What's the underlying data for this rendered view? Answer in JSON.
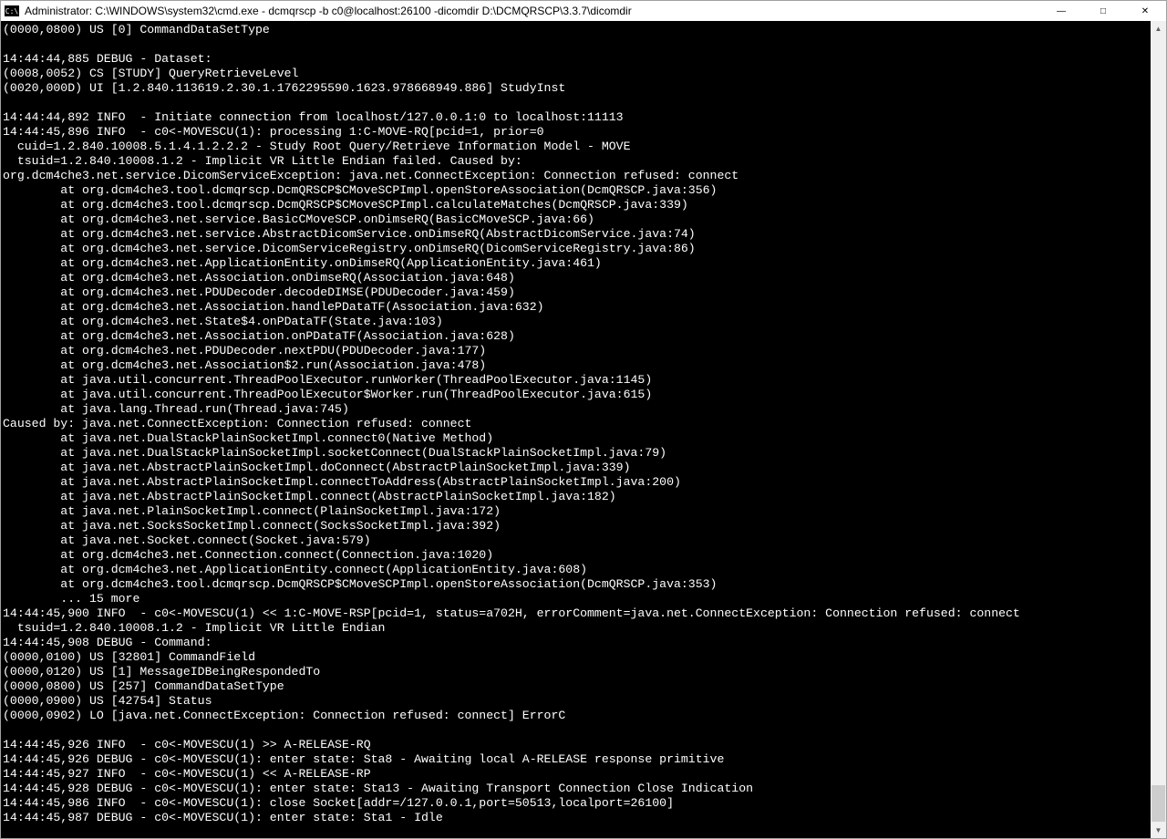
{
  "window": {
    "icon_label": "C:\\",
    "title": "Administrator: C:\\WINDOWS\\system32\\cmd.exe - dcmqrscp  -b c0@localhost:26100 -dicomdir D:\\DCMQRSCP\\3.3.7\\dicomdir"
  },
  "controls": {
    "minimize": "—",
    "maximize": "□",
    "close": "✕"
  },
  "terminal_lines": [
    "(0000,0800) US [0] CommandDataSetType",
    "",
    "14:44:44,885 DEBUG - Dataset:",
    "(0008,0052) CS [STUDY] QueryRetrieveLevel",
    "(0020,000D) UI [1.2.840.113619.2.30.1.1762295590.1623.978668949.886] StudyInst",
    "",
    "14:44:44,892 INFO  - Initiate connection from localhost/127.0.0.1:0 to localhost:11113",
    "14:44:45,896 INFO  - c0<-MOVESCU(1): processing 1:C-MOVE-RQ[pcid=1, prior=0",
    "  cuid=1.2.840.10008.5.1.4.1.2.2.2 - Study Root Query/Retrieve Information Model - MOVE",
    "  tsuid=1.2.840.10008.1.2 - Implicit VR Little Endian failed. Caused by:",
    "org.dcm4che3.net.service.DicomServiceException: java.net.ConnectException: Connection refused: connect",
    "        at org.dcm4che3.tool.dcmqrscp.DcmQRSCP$CMoveSCPImpl.openStoreAssociation(DcmQRSCP.java:356)",
    "        at org.dcm4che3.tool.dcmqrscp.DcmQRSCP$CMoveSCPImpl.calculateMatches(DcmQRSCP.java:339)",
    "        at org.dcm4che3.net.service.BasicCMoveSCP.onDimseRQ(BasicCMoveSCP.java:66)",
    "        at org.dcm4che3.net.service.AbstractDicomService.onDimseRQ(AbstractDicomService.java:74)",
    "        at org.dcm4che3.net.service.DicomServiceRegistry.onDimseRQ(DicomServiceRegistry.java:86)",
    "        at org.dcm4che3.net.ApplicationEntity.onDimseRQ(ApplicationEntity.java:461)",
    "        at org.dcm4che3.net.Association.onDimseRQ(Association.java:648)",
    "        at org.dcm4che3.net.PDUDecoder.decodeDIMSE(PDUDecoder.java:459)",
    "        at org.dcm4che3.net.Association.handlePDataTF(Association.java:632)",
    "        at org.dcm4che3.net.State$4.onPDataTF(State.java:103)",
    "        at org.dcm4che3.net.Association.onPDataTF(Association.java:628)",
    "        at org.dcm4che3.net.PDUDecoder.nextPDU(PDUDecoder.java:177)",
    "        at org.dcm4che3.net.Association$2.run(Association.java:478)",
    "        at java.util.concurrent.ThreadPoolExecutor.runWorker(ThreadPoolExecutor.java:1145)",
    "        at java.util.concurrent.ThreadPoolExecutor$Worker.run(ThreadPoolExecutor.java:615)",
    "        at java.lang.Thread.run(Thread.java:745)",
    "Caused by: java.net.ConnectException: Connection refused: connect",
    "        at java.net.DualStackPlainSocketImpl.connect0(Native Method)",
    "        at java.net.DualStackPlainSocketImpl.socketConnect(DualStackPlainSocketImpl.java:79)",
    "        at java.net.AbstractPlainSocketImpl.doConnect(AbstractPlainSocketImpl.java:339)",
    "        at java.net.AbstractPlainSocketImpl.connectToAddress(AbstractPlainSocketImpl.java:200)",
    "        at java.net.AbstractPlainSocketImpl.connect(AbstractPlainSocketImpl.java:182)",
    "        at java.net.PlainSocketImpl.connect(PlainSocketImpl.java:172)",
    "        at java.net.SocksSocketImpl.connect(SocksSocketImpl.java:392)",
    "        at java.net.Socket.connect(Socket.java:579)",
    "        at org.dcm4che3.net.Connection.connect(Connection.java:1020)",
    "        at org.dcm4che3.net.ApplicationEntity.connect(ApplicationEntity.java:608)",
    "        at org.dcm4che3.tool.dcmqrscp.DcmQRSCP$CMoveSCPImpl.openStoreAssociation(DcmQRSCP.java:353)",
    "        ... 15 more",
    "14:44:45,900 INFO  - c0<-MOVESCU(1) << 1:C-MOVE-RSP[pcid=1, status=a702H, errorComment=java.net.ConnectException: Connection refused: connect",
    "  tsuid=1.2.840.10008.1.2 - Implicit VR Little Endian",
    "14:44:45,908 DEBUG - Command:",
    "(0000,0100) US [32801] CommandField",
    "(0000,0120) US [1] MessageIDBeingRespondedTo",
    "(0000,0800) US [257] CommandDataSetType",
    "(0000,0900) US [42754] Status",
    "(0000,0902) LO [java.net.ConnectException: Connection refused: connect] ErrorC",
    "",
    "14:44:45,926 INFO  - c0<-MOVESCU(1) >> A-RELEASE-RQ",
    "14:44:45,926 DEBUG - c0<-MOVESCU(1): enter state: Sta8 - Awaiting local A-RELEASE response primitive",
    "14:44:45,927 INFO  - c0<-MOVESCU(1) << A-RELEASE-RP",
    "14:44:45,928 DEBUG - c0<-MOVESCU(1): enter state: Sta13 - Awaiting Transport Connection Close Indication",
    "14:44:45,986 INFO  - c0<-MOVESCU(1): close Socket[addr=/127.0.0.1,port=50513,localport=26100]",
    "14:44:45,987 DEBUG - c0<-MOVESCU(1): enter state: Sta1 - Idle"
  ],
  "scrollbar": {
    "up": "▲",
    "down": "▼"
  }
}
